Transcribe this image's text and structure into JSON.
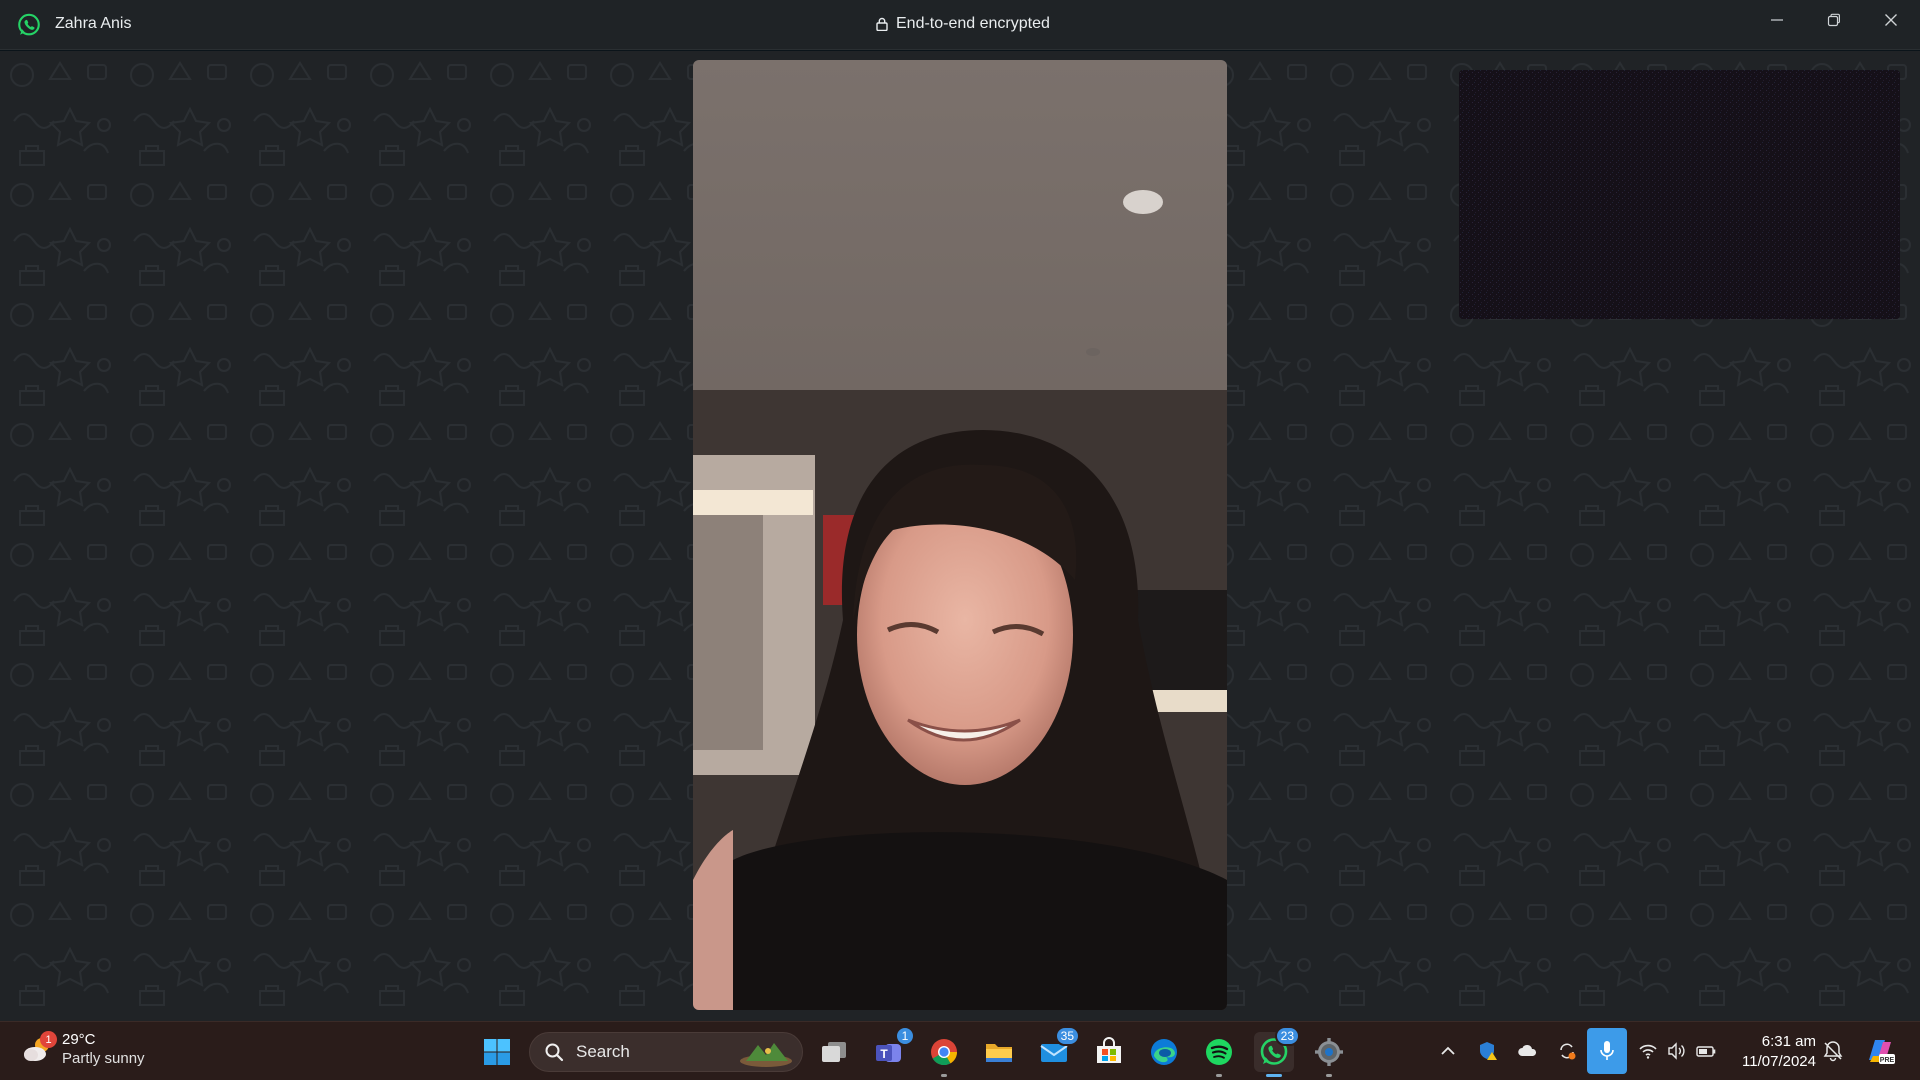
{
  "titlebar": {
    "app_icon": "whatsapp-icon",
    "contact_name": "Zahra Anis",
    "encryption_label": "End-to-end encrypted",
    "encryption_icon": "lock-icon",
    "controls": [
      "minimize-icon",
      "restore-icon",
      "close-icon"
    ]
  },
  "call": {
    "remote_video": "video-feed",
    "self_view": "video-feed",
    "background": "doodle-pattern",
    "background_color": "#202326"
  },
  "taskbar": {
    "weather": {
      "temperature": "29°C",
      "condition": "Partly sunny",
      "badge": "1",
      "icon": "weather-icon"
    },
    "start_icon": "windows-start-icon",
    "search": {
      "label": "Search",
      "icon": "search-icon"
    },
    "apps": [
      {
        "name": "task-view",
        "icon": "task-view-icon"
      },
      {
        "name": "teams",
        "icon": "teams-icon",
        "badge": "1"
      },
      {
        "name": "chrome",
        "icon": "chrome-icon"
      },
      {
        "name": "file-explorer",
        "icon": "folder-icon"
      },
      {
        "name": "mail",
        "icon": "mail-icon",
        "badge": "35"
      },
      {
        "name": "store",
        "icon": "store-icon"
      },
      {
        "name": "edge",
        "icon": "edge-icon"
      },
      {
        "name": "spotify",
        "icon": "spotify-icon"
      },
      {
        "name": "whatsapp",
        "icon": "whatsapp-icon",
        "badge": "23",
        "active": true
      },
      {
        "name": "settings",
        "icon": "settings-icon"
      }
    ],
    "tray": {
      "icons": [
        "chevron-up-icon",
        "defender-warning-icon",
        "onedrive-icon",
        "sync-icon",
        "microphone-icon",
        "wifi-icon",
        "volume-icon",
        "battery-icon"
      ],
      "time": "6:31 am",
      "date": "11/07/2024",
      "notification_icon": "notification-bell-icon",
      "copilot_icon": "copilot-icon"
    }
  },
  "colors": {
    "titlebar_bg": "#1f2326",
    "taskbar_bg": "#2a1c1a",
    "whatsapp_green": "#25d366",
    "mic_active": "#3d9be9",
    "badge_blue": "#3b8ee0"
  }
}
